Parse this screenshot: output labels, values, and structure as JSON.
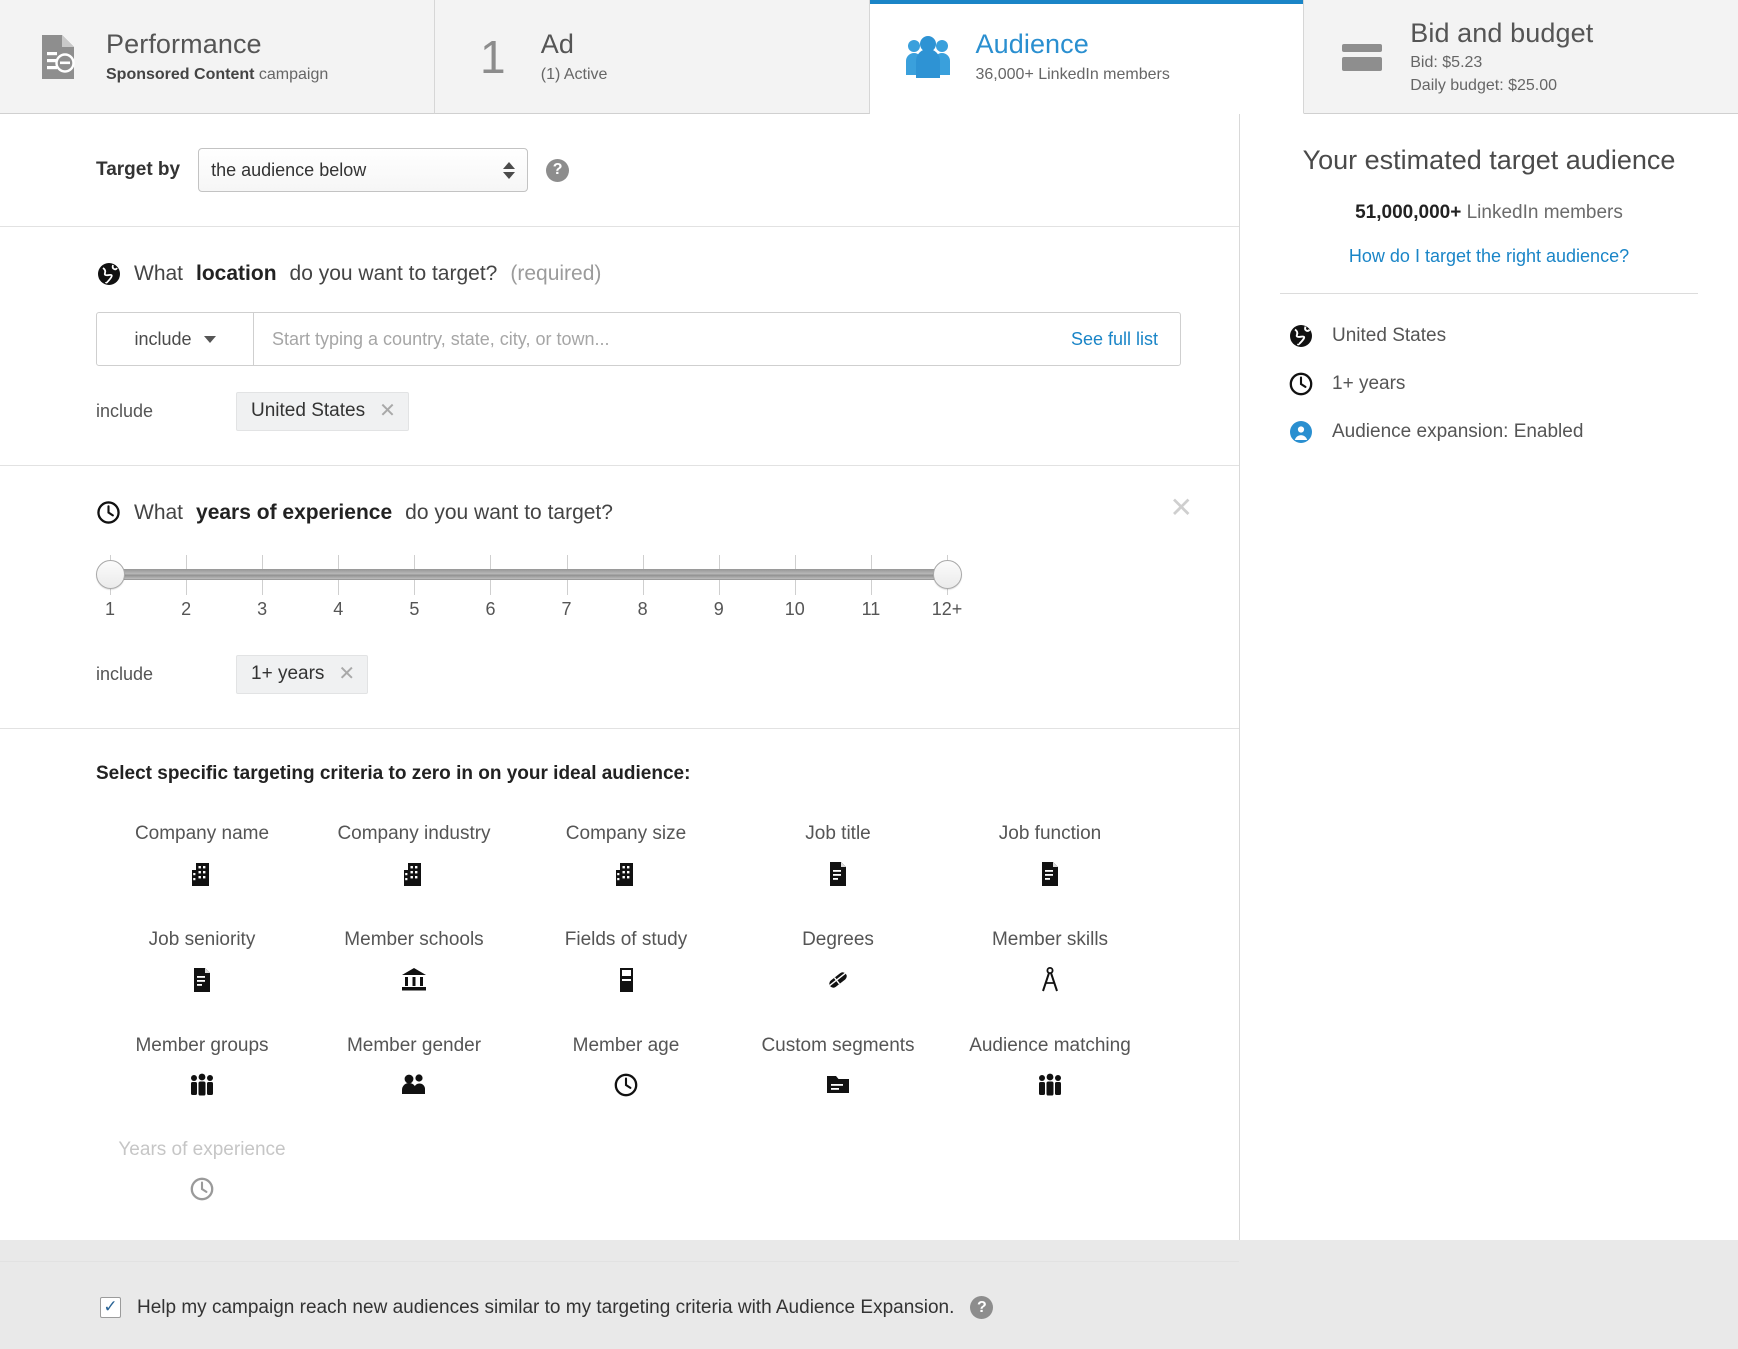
{
  "tabs": [
    {
      "id": "performance",
      "icon": "document-chart-icon",
      "title": "Performance",
      "sub_bold": "Sponsored Content",
      "sub_rest": " campaign",
      "active": false
    },
    {
      "id": "ad",
      "icon": "count-1",
      "number": "1",
      "title": "Ad",
      "sub": "(1) Active",
      "active": false
    },
    {
      "id": "audience",
      "icon": "people-icon",
      "title": "Audience",
      "sub": "36,000+ LinkedIn members",
      "active": true
    },
    {
      "id": "bid-budget",
      "icon": "card-icon",
      "title": "Bid and budget",
      "sub_line1": "Bid:  $5.23",
      "sub_line2": "Daily budget:  $25.00",
      "active": false
    }
  ],
  "target_by": {
    "label": "Target by",
    "selected": "the audience below",
    "help_icon": "question-mark-icon"
  },
  "location": {
    "icon": "globe-icon",
    "q_pre": "What ",
    "q_bold": "location",
    "q_post": " do you want to target? ",
    "q_required": "(required)",
    "include_label": "include",
    "placeholder": "Start typing a country, state, city, or town...",
    "value": "",
    "see_full_list": "See full list",
    "chip_lead": "include",
    "chips": [
      {
        "label": "United States"
      }
    ]
  },
  "experience": {
    "icon": "clock-icon",
    "q_pre": "What ",
    "q_bold": "years of experience",
    "q_post": " do you want to target?",
    "close_icon": "close-icon",
    "ticks": [
      "1",
      "2",
      "3",
      "4",
      "5",
      "6",
      "7",
      "8",
      "9",
      "10",
      "11",
      "12+"
    ],
    "range_min_index": 0,
    "range_max_index": 11,
    "include_label": "include",
    "chips": [
      {
        "label": "1+ years"
      }
    ]
  },
  "criteria": {
    "heading": "Select specific targeting criteria to zero in on your ideal audience:",
    "items": [
      {
        "label": "Company name",
        "icon": "building-icon",
        "glyph": "🏢",
        "disabled": false
      },
      {
        "label": "Company industry",
        "icon": "building-icon",
        "glyph": "🏢",
        "disabled": false
      },
      {
        "label": "Company size",
        "icon": "building-icon",
        "glyph": "🏢",
        "disabled": false
      },
      {
        "label": "Job title",
        "icon": "document-icon",
        "glyph": "📄",
        "disabled": false
      },
      {
        "label": "Job function",
        "icon": "document-icon",
        "glyph": "📄",
        "disabled": false
      },
      {
        "label": "Job seniority",
        "icon": "document-icon",
        "glyph": "📄",
        "disabled": false
      },
      {
        "label": "Member schools",
        "icon": "bank-icon",
        "glyph": "🏦",
        "disabled": false
      },
      {
        "label": "Fields of study",
        "icon": "book-icon",
        "glyph": "📓",
        "disabled": false
      },
      {
        "label": "Degrees",
        "icon": "diploma-icon",
        "glyph": "🎓",
        "disabled": false
      },
      {
        "label": "Member skills",
        "icon": "compass-icon",
        "glyph": "📐",
        "disabled": false
      },
      {
        "label": "Member groups",
        "icon": "people-icon",
        "glyph": "👥",
        "disabled": false
      },
      {
        "label": "Member gender",
        "icon": "two-people-icon",
        "glyph": "👥",
        "disabled": false
      },
      {
        "label": "Member age",
        "icon": "clock-icon",
        "glyph": "🕒",
        "disabled": false
      },
      {
        "label": "Custom segments",
        "icon": "folder-icon",
        "glyph": "📁",
        "disabled": false
      },
      {
        "label": "Audience matching",
        "icon": "people-icon",
        "glyph": "👥",
        "disabled": false
      },
      {
        "label": "Years of experience",
        "icon": "clock-icon",
        "glyph": "🕒",
        "disabled": true
      }
    ]
  },
  "audience_expansion": {
    "checked": true,
    "check_icon": "checkmark-icon",
    "label": "Help my campaign reach new audiences similar to my targeting criteria with Audience Expansion.",
    "help_icon": "question-mark-icon"
  },
  "sidebar": {
    "title": "Your estimated target audience",
    "count_bold": "51,000,000+",
    "count_rest": " LinkedIn members",
    "link": "How do I target the right audience?",
    "summary": [
      {
        "icon": "globe-icon",
        "glyph": "🌍",
        "text": "United States",
        "blue": false
      },
      {
        "icon": "clock-icon",
        "glyph": "🕒",
        "text": "1+ years",
        "blue": false
      },
      {
        "icon": "audience-expansion-icon",
        "glyph": "◉",
        "text": "Audience expansion:  Enabled",
        "blue": true
      }
    ]
  },
  "colors": {
    "accent": "#1a85c7",
    "tab_active": "#2a8fd0",
    "border": "#d9d9d9"
  }
}
